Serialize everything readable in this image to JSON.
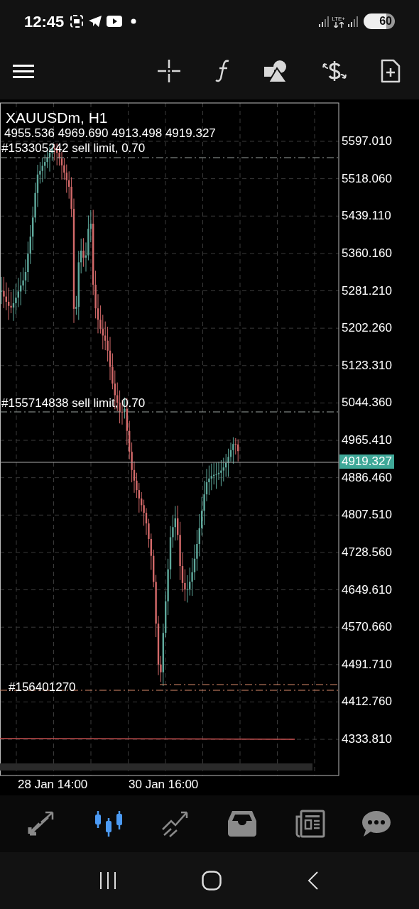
{
  "status_bar": {
    "time": "12:45",
    "network": "LTE+",
    "battery": "60"
  },
  "chart": {
    "title": "XAUUSDm, H1",
    "ohlc": "4955.536 4969.690 4913.498 4919.327",
    "orders": [
      {
        "label": "#153305242 sell limit, 0.70",
        "kind": "sell"
      },
      {
        "label": "#155714838 sell limit, 0.70",
        "kind": "sell"
      },
      {
        "label": "#156401270",
        "kind": "stop"
      }
    ],
    "price_labels": [
      "5597.010",
      "5518.060",
      "5439.110",
      "5360.160",
      "5281.210",
      "5202.260",
      "5123.310",
      "5044.360",
      "4965.410",
      "4886.460",
      "4807.510",
      "4728.560",
      "4649.610",
      "4570.660",
      "4491.710",
      "4412.760",
      "4333.810"
    ],
    "current_price": "4919.327",
    "time_labels": [
      "28 Jan 14:00",
      "30 Jan 16:00"
    ]
  },
  "bottom_nav": [
    {
      "kind": "quotes",
      "selected": false
    },
    {
      "kind": "chart",
      "selected": true
    },
    {
      "kind": "trade",
      "selected": false
    },
    {
      "kind": "history",
      "selected": false
    },
    {
      "kind": "news",
      "selected": false
    },
    {
      "kind": "chat",
      "selected": false
    }
  ]
}
